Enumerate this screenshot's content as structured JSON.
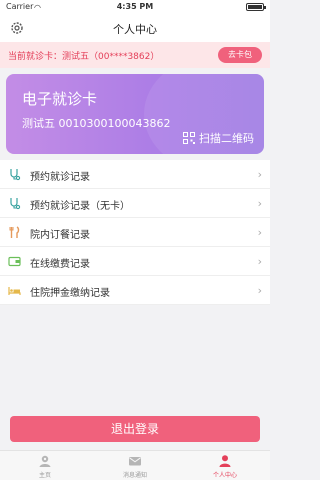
{
  "status_bar": {
    "carrier": "Carrier",
    "time": "4:35 PM"
  },
  "nav": {
    "title": "个人中心"
  },
  "card_banner": {
    "label": "当前就诊卡：测试五（00****3862）",
    "button": "去卡包"
  },
  "medical_card": {
    "title": "电子就诊卡",
    "holder_number": "测试五 0010300100043862",
    "qr_label": "扫描二维码"
  },
  "menu": [
    {
      "label": "预约就诊记录"
    },
    {
      "label": "预约就诊记录（无卡）"
    },
    {
      "label": "院内订餐记录"
    },
    {
      "label": "在线缴费记录"
    },
    {
      "label": "住院押金缴纳记录"
    }
  ],
  "logout_label": "退出登录",
  "tabs": [
    {
      "label": "主页"
    },
    {
      "label": "消息通知"
    },
    {
      "label": "个人中心"
    }
  ],
  "colors": {
    "accent": "#f0617c",
    "card_gradient_start": "#c38de6",
    "card_gradient_end": "#a07de4"
  }
}
